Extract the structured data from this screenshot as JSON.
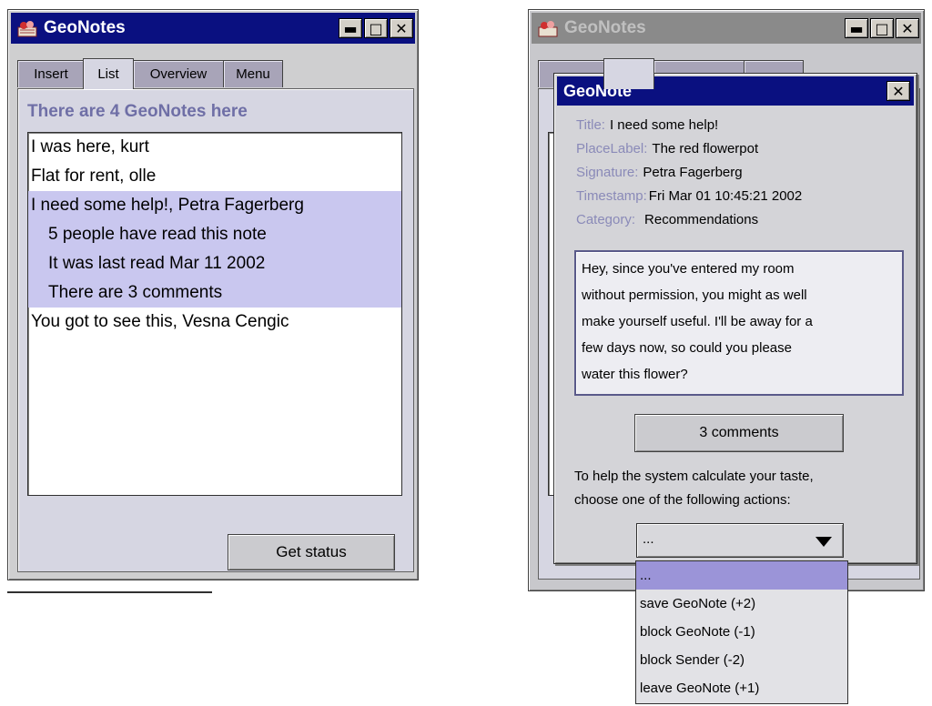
{
  "left_window": {
    "title": "GeoNotes",
    "tabs": [
      {
        "label": "Insert"
      },
      {
        "label": "List"
      },
      {
        "label": "Overview"
      },
      {
        "label": "Menu"
      }
    ],
    "active_tab": "List",
    "heading": "There are 4 GeoNotes here",
    "list": [
      {
        "text": "I was here, kurt"
      },
      {
        "text": "Flat for rent, olle"
      },
      {
        "text": "I need some help!, Petra Fagerberg"
      },
      {
        "text": "5 people have read this note"
      },
      {
        "text": "It was last read Mar 11 2002"
      },
      {
        "text": "There are 3 comments"
      },
      {
        "text": "You got to see this, Vesna Cengic"
      }
    ],
    "status_button": "Get status"
  },
  "right_window": {
    "title": "GeoNotes"
  },
  "dialog": {
    "title": "GeoNote",
    "fields": [
      {
        "label": "Title:",
        "value": "I need some help!"
      },
      {
        "label": "PlaceLabel:",
        "value": "The red flowerpot"
      },
      {
        "label": "Signature:",
        "value": "Petra Fagerberg"
      },
      {
        "label": "Timestamp:",
        "value": "Fri Mar 01 10:45:21 2002"
      },
      {
        "label": "Category:",
        "value": "Recommendations"
      }
    ],
    "message_lines": [
      "Hey, since you've entered my room",
      "without permission, you might as well",
      "make yourself useful. I'll be away for a",
      "few days now, so could you please",
      "water this flower?"
    ],
    "comments_button": "3 comments",
    "taste_text_1": "To help the system calculate your taste,",
    "taste_text_2": "choose one of the following actions:",
    "select_value": "...",
    "options": [
      {
        "label": "..."
      },
      {
        "label": "save GeoNote (+2)"
      },
      {
        "label": "block GeoNote (-1)"
      },
      {
        "label": "block Sender (-2)"
      },
      {
        "label": "leave GeoNote (+1)"
      }
    ]
  },
  "colors": {
    "titlebar_active": "#0a1080",
    "heading": "#6f6fa6",
    "selection": "#c9c7ef",
    "dropdown_selection": "#9b94d8"
  },
  "icons": {
    "app": "geonotes-app-icon",
    "minimize": "minimize-icon",
    "maximize": "maximize-icon",
    "close": "close-icon",
    "dropdown": "triangle-down-icon"
  }
}
